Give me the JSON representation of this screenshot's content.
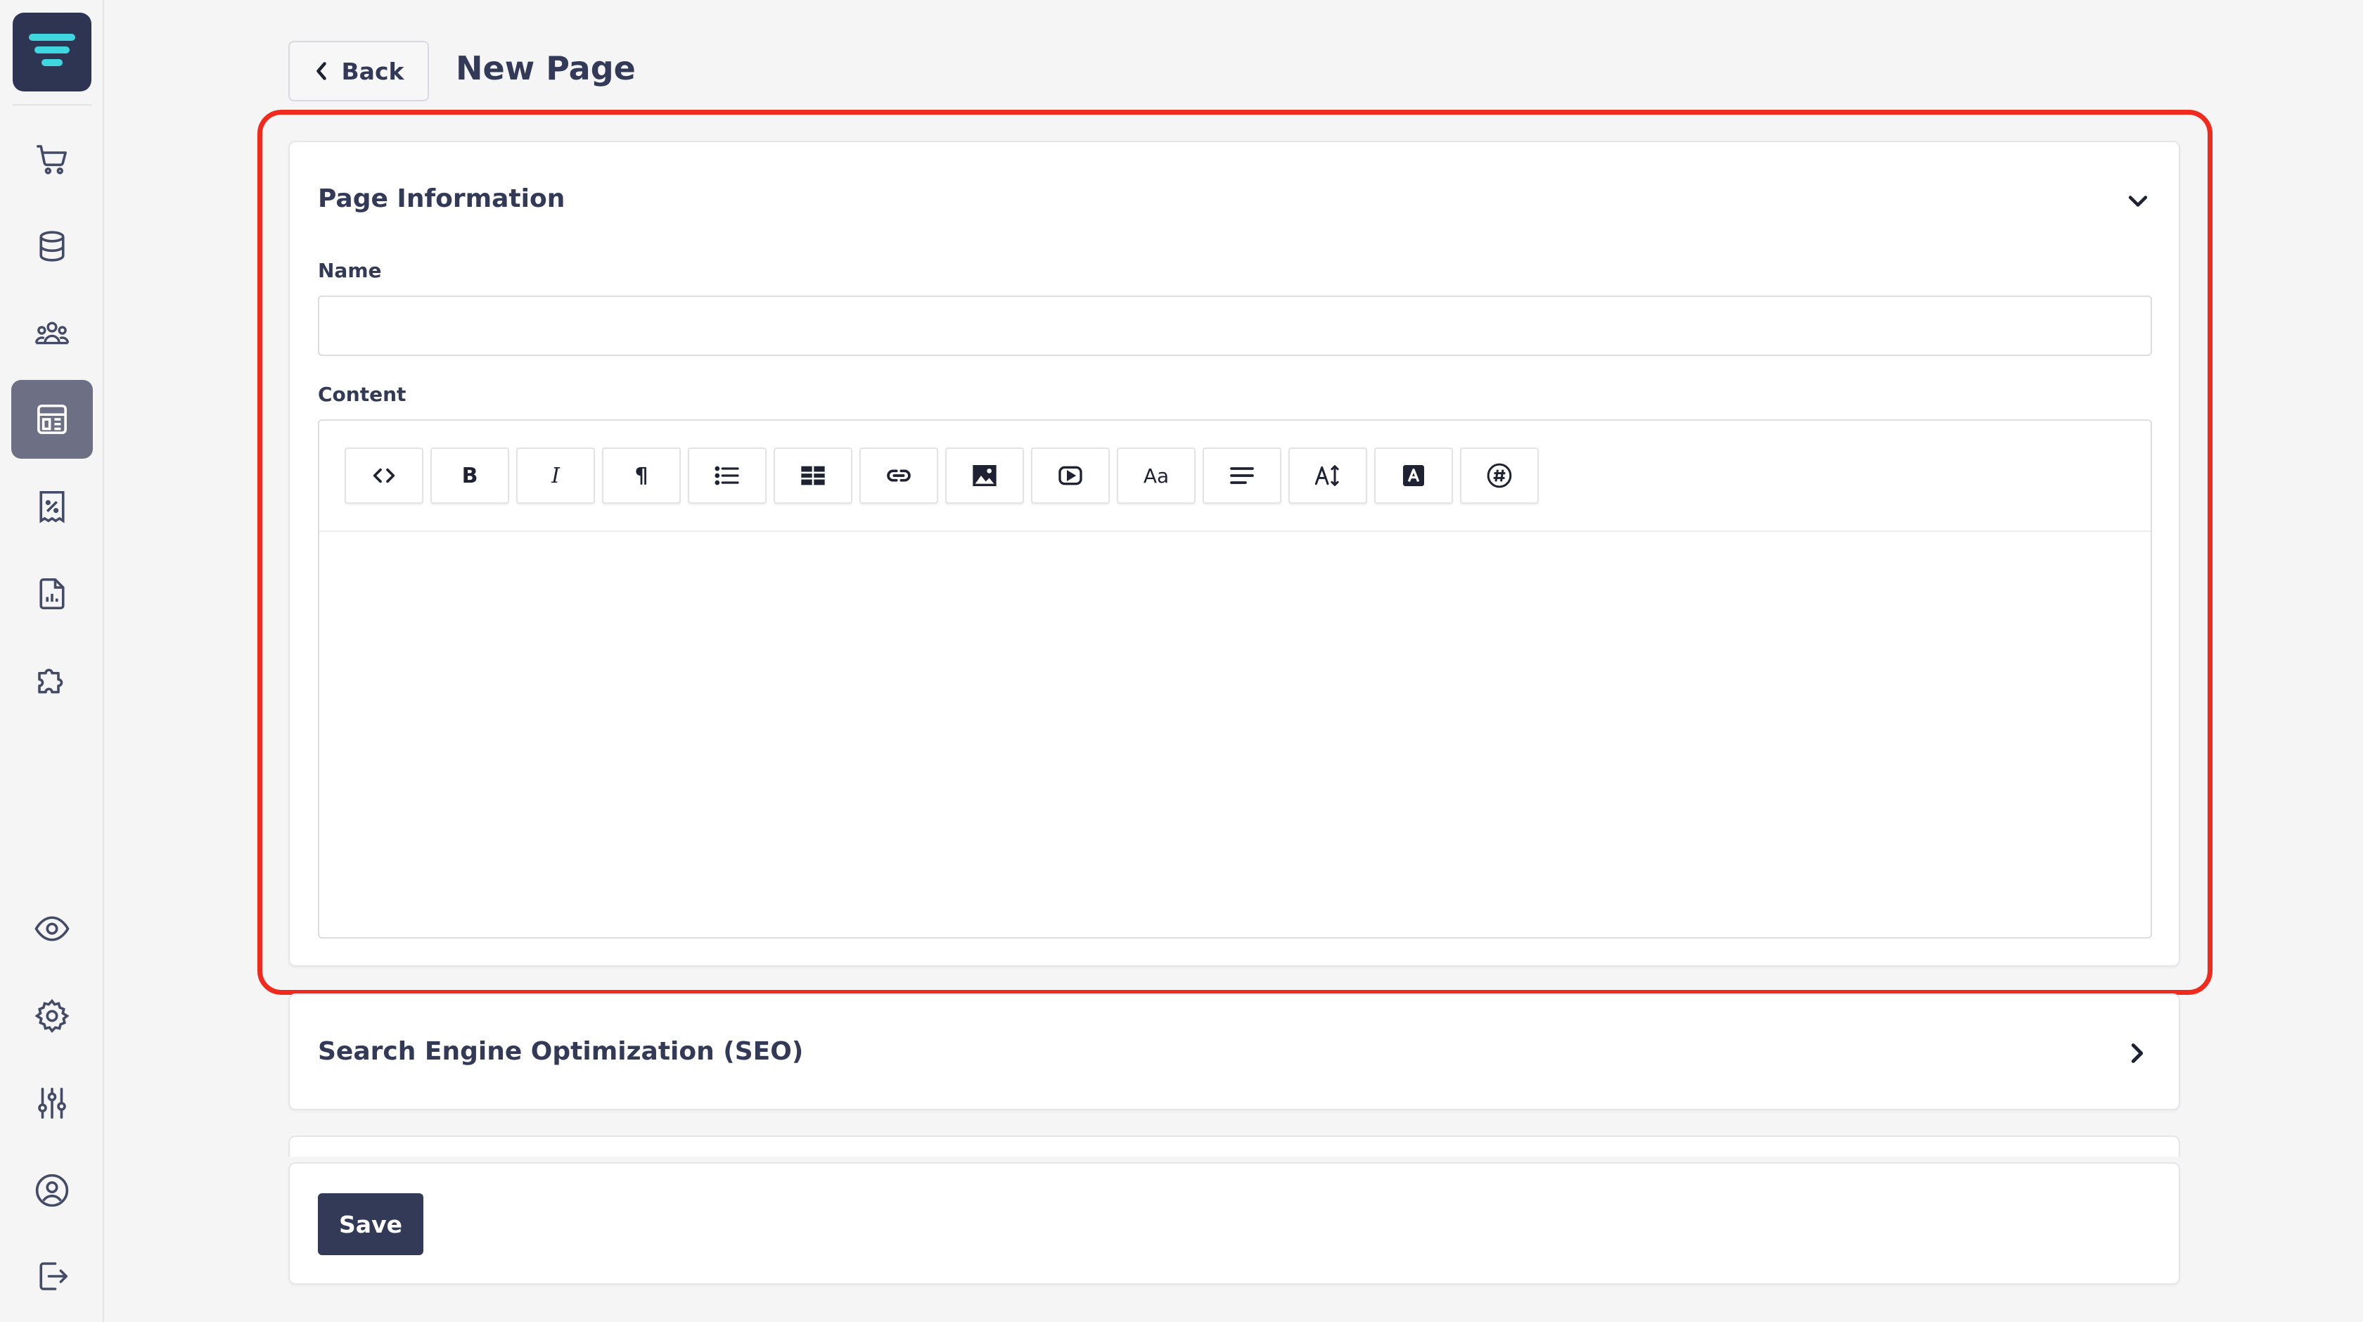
{
  "sidebar": {
    "logo": "logo-icon",
    "items": [
      {
        "icon": "cart-icon",
        "active": false
      },
      {
        "icon": "database-icon",
        "active": false
      },
      {
        "icon": "users-icon",
        "active": false
      },
      {
        "icon": "layout-icon",
        "active": true
      },
      {
        "icon": "discount-receipt-icon",
        "active": false
      },
      {
        "icon": "report-icon",
        "active": false
      },
      {
        "icon": "puzzle-icon",
        "active": false
      },
      {
        "icon": "eye-icon",
        "active": false
      },
      {
        "icon": "gear-icon",
        "active": false
      },
      {
        "icon": "sliders-icon",
        "active": false
      },
      {
        "icon": "user-circle-icon",
        "active": false
      },
      {
        "icon": "logout-icon",
        "active": false
      }
    ]
  },
  "header": {
    "back_label": "Back",
    "title": "New Page"
  },
  "page_info": {
    "heading": "Page Information",
    "name_label": "Name",
    "name_value": "",
    "content_label": "Content",
    "toolbar": [
      "code-view-icon",
      "bold-icon",
      "italic-icon",
      "paragraph-icon",
      "bullet-list-icon",
      "table-icon",
      "link-icon",
      "image-icon",
      "video-icon",
      "font-size-icon",
      "align-icon",
      "line-height-icon",
      "text-color-icon",
      "special-char-icon"
    ],
    "toolbar_text": {
      "bold": "B",
      "italic": "I",
      "paragraph": "¶",
      "font": "Aa"
    }
  },
  "seo": {
    "heading": "Search Engine Optimization (SEO)"
  },
  "actions": {
    "save_label": "Save"
  },
  "colors": {
    "primary": "#333a57",
    "highlight": "#f02a1c",
    "logo_accent": "#3fd6e0",
    "active_nav": "#6d7085"
  }
}
